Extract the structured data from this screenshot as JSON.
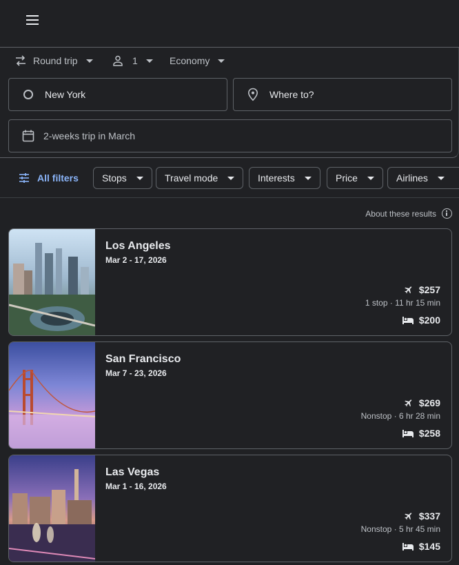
{
  "options": {
    "trip_type": "Round trip",
    "passengers": "1",
    "cabin": "Economy"
  },
  "search": {
    "origin": "New York",
    "destination_placeholder": "Where to?",
    "dates": "2-weeks trip in March"
  },
  "filters": {
    "all_label": "All filters",
    "chips": [
      "Stops",
      "Travel mode",
      "Interests",
      "Price",
      "Airlines"
    ]
  },
  "about_label": "About these results",
  "results": [
    {
      "city": "Los Angeles",
      "dates": "Mar 2 - 17, 2026",
      "flight_price": "$257",
      "flight_detail": "1 stop · 11 hr 15 min",
      "hotel_price": "$200"
    },
    {
      "city": "San Francisco",
      "dates": "Mar 7 - 23, 2026",
      "flight_price": "$269",
      "flight_detail": "Nonstop · 6 hr 28 min",
      "hotel_price": "$258"
    },
    {
      "city": "Las Vegas",
      "dates": "Mar 1 - 16, 2026",
      "flight_price": "$337",
      "flight_detail": "Nonstop · 5 hr 45 min",
      "hotel_price": "$145"
    }
  ],
  "colors": {
    "background": "#202124",
    "accent": "#8ab4f8",
    "border": "#5f6368"
  }
}
